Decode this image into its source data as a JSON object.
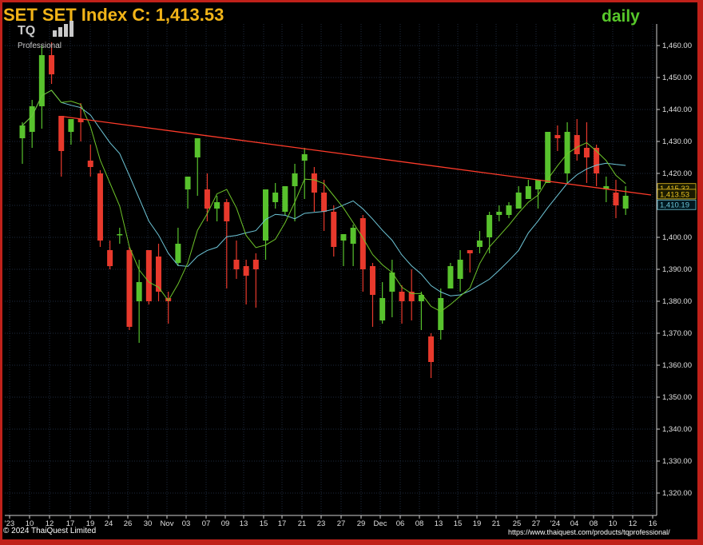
{
  "header": {
    "title": "SET  SET Index C: 1,413.53",
    "period": "daily",
    "logo_text": "TQ",
    "logo_sub": "Professional"
  },
  "footer": {
    "copyright": "© 2024 ThaiQuest Limited",
    "url": "https://www.thaiquest.com/products/tqprofessional/"
  },
  "colors": {
    "up": "#58c22d",
    "down": "#e8392c",
    "ma_short": "#6ec42a",
    "ma_long": "#6ec6d8",
    "trendline": "#ff3b2a",
    "grid": "#1e2a3e",
    "background": "#000000"
  },
  "chart_data": {
    "type": "candlestick",
    "title": "SET  SET Index C: 1,413.53",
    "ylim": [
      1315,
      1467
    ],
    "y_ticks": [
      "1,460.00",
      "1,450.00",
      "1,440.00",
      "1,430.00",
      "1,420.00",
      "1,410.00",
      "1,400.00",
      "1,390.00",
      "1,380.00",
      "1,370.00",
      "1,360.00",
      "1,350.00",
      "1,340.00",
      "1,330.00",
      "1,320.00"
    ],
    "x_ticks": [
      "'23",
      "10",
      "12",
      "17",
      "19",
      "24",
      "26",
      "30",
      "Nov",
      "03",
      "07",
      "09",
      "13",
      "15",
      "17",
      "21",
      "23",
      "27",
      "29",
      "Dec",
      "06",
      "08",
      "13",
      "15",
      "19",
      "21",
      "25",
      "27",
      "'24",
      "04",
      "08",
      "10",
      "12",
      "16"
    ],
    "price_labels": [
      {
        "text": "1,415.32",
        "value": 1415.32
      },
      {
        "text": "1,413.53",
        "value": 1413.53
      },
      {
        "text": "1,410.19",
        "value": 1410.19
      }
    ],
    "candles": [
      [
        1431,
        1436,
        1423,
        1435
      ],
      [
        1433,
        1443,
        1428,
        1441
      ],
      [
        1441,
        1460,
        1434,
        1457
      ],
      [
        1457,
        1461,
        1448,
        1451
      ],
      [
        1438,
        1436,
        1419,
        1427
      ],
      [
        1433,
        1435,
        1429,
        1437
      ],
      [
        1437,
        1442,
        1430,
        1436
      ],
      [
        1424,
        1429,
        1419,
        1422
      ],
      [
        1420,
        1421,
        1397,
        1399
      ],
      [
        1396,
        1399,
        1390,
        1391
      ],
      [
        1401,
        1403,
        1398,
        1401
      ],
      [
        1396,
        1397,
        1371,
        1372
      ],
      [
        1380,
        1393,
        1367,
        1386
      ],
      [
        1396,
        1393,
        1379,
        1380
      ],
      [
        1394,
        1398,
        1380,
        1383
      ],
      [
        1381,
        1383,
        1373,
        1380
      ],
      [
        1392,
        1403,
        1391,
        1398
      ],
      [
        1415,
        1416,
        1409,
        1419
      ],
      [
        1425,
        1431,
        1413,
        1431
      ],
      [
        1415,
        1420,
        1405,
        1409
      ],
      [
        1409,
        1413,
        1405,
        1411
      ],
      [
        1411,
        1412,
        1384,
        1405
      ],
      [
        1393,
        1399,
        1387,
        1390
      ],
      [
        1391,
        1393,
        1379,
        1388
      ],
      [
        1393,
        1395,
        1378,
        1390
      ],
      [
        1399,
        1401,
        1393,
        1415
      ],
      [
        1411,
        1417,
        1409,
        1414
      ],
      [
        1408,
        1407,
        1407,
        1416
      ],
      [
        1416,
        1423,
        1405,
        1420
      ],
      [
        1424,
        1428,
        1412,
        1426
      ],
      [
        1420,
        1422,
        1408,
        1414
      ],
      [
        1414,
        1418,
        1402,
        1408
      ],
      [
        1408,
        1410,
        1394,
        1397
      ],
      [
        1399,
        1400,
        1391,
        1401
      ],
      [
        1398,
        1404,
        1391,
        1403
      ],
      [
        1406,
        1407,
        1383,
        1390
      ],
      [
        1391,
        1392,
        1372,
        1382
      ],
      [
        1374,
        1386,
        1373,
        1381
      ],
      [
        1383,
        1393,
        1375,
        1389
      ],
      [
        1383,
        1385,
        1373,
        1380
      ],
      [
        1383,
        1390,
        1374,
        1380
      ],
      [
        1380,
        1383,
        1371,
        1382
      ],
      [
        1369,
        1370,
        1356,
        1361
      ],
      [
        1371,
        1384,
        1368,
        1381
      ],
      [
        1384,
        1392,
        1386,
        1391
      ],
      [
        1387,
        1396,
        1383,
        1393
      ],
      [
        1396,
        1394,
        1389,
        1395
      ],
      [
        1397,
        1402,
        1395,
        1399
      ],
      [
        1400,
        1408,
        1395,
        1407
      ],
      [
        1407,
        1410,
        1405,
        1408
      ],
      [
        1407,
        1411,
        1406,
        1410
      ],
      [
        1409,
        1416,
        1409,
        1414
      ],
      [
        1412,
        1418,
        1414,
        1416
      ],
      [
        1415,
        1417,
        1409,
        1418
      ],
      [
        1417,
        1433,
        1423,
        1433
      ],
      [
        1432,
        1435,
        1427,
        1431
      ],
      [
        1420,
        1436,
        1417,
        1433
      ],
      [
        1432,
        1437,
        1424,
        1426
      ],
      [
        1428,
        1436,
        1417,
        1425
      ],
      [
        1428,
        1429,
        1416,
        1420
      ],
      [
        1415,
        1419,
        1411,
        1416
      ],
      [
        1414,
        1418,
        1406,
        1410
      ],
      [
        1409,
        1416,
        1407,
        1413
      ]
    ]
  }
}
